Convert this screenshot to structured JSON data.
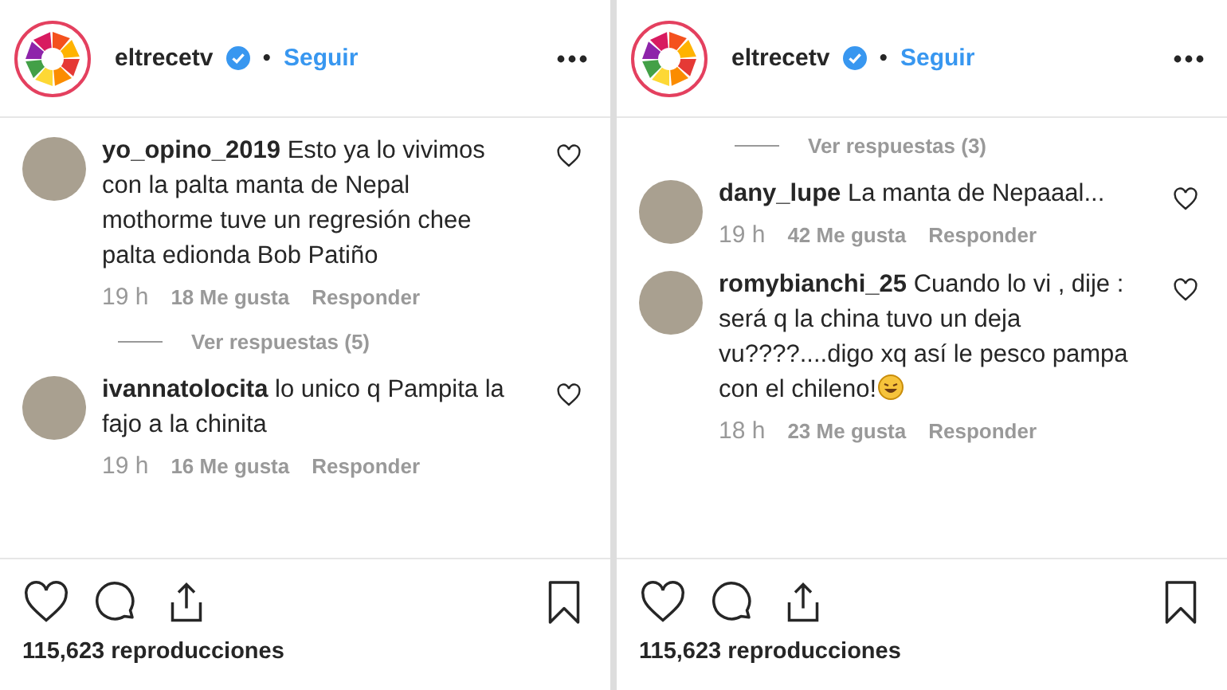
{
  "panels": [
    {
      "header": {
        "username": "eltrecetv",
        "separator": "•",
        "follow": "Seguir"
      },
      "items": [
        {
          "kind": "comment",
          "username": "yo_opino_2019",
          "text": "Esto ya lo vivimos con la palta manta de Nepal mothorme tuve un regresión chee palta edionda Bob Patiño",
          "time": "19 h",
          "likes": "18 Me gusta",
          "reply": "Responder"
        },
        {
          "kind": "replies",
          "label": "Ver respuestas (5)"
        },
        {
          "kind": "comment",
          "username": "ivannatolocita",
          "text": "lo unico q Pampita la fajo a la chinita",
          "time": "19 h",
          "likes": "16 Me gusta",
          "reply": "Responder"
        }
      ],
      "views": "115,623 reproducciones"
    },
    {
      "header": {
        "username": "eltrecetv",
        "separator": "•",
        "follow": "Seguir"
      },
      "items": [
        {
          "kind": "replies",
          "label": "Ver respuestas (3)"
        },
        {
          "kind": "comment",
          "username": "dany_lupe",
          "text": "La manta de Nepaaal...",
          "time": "19 h",
          "likes": "42 Me gusta",
          "reply": "Responder"
        },
        {
          "kind": "comment",
          "username": "romybianchi_25",
          "text": "Cuando lo vi , dije : será q la china tuvo un deja vu????....digo xq así le pesco pampa con el chileno!",
          "trailing_emoji": true,
          "time": "18 h",
          "likes": "23 Me gusta",
          "reply": "Responder"
        }
      ],
      "views": "115,623 reproducciones"
    }
  ]
}
